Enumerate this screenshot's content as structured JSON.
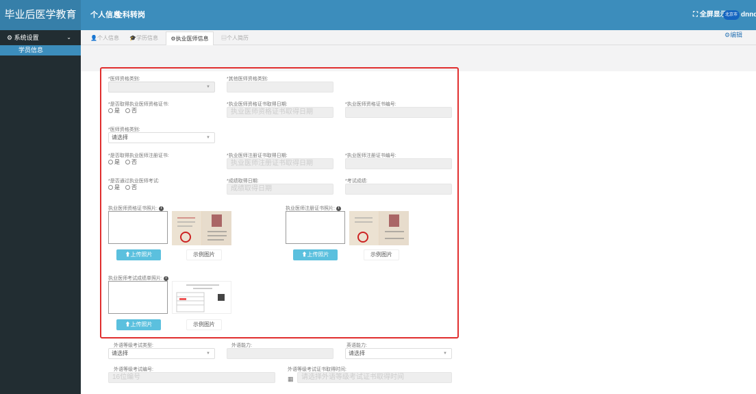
{
  "app": {
    "title": "毕业后医学教育",
    "nav": [
      "个人信息",
      "全科转岗"
    ],
    "fullscreen": "全屏显示",
    "avatar_text": "北京市",
    "username": "dnndnd"
  },
  "sidebar": {
    "group": "系统设置",
    "item": "学员信息"
  },
  "tabs": [
    "个人信息",
    "学历信息",
    "执业医师信息",
    "个人简历"
  ],
  "edit_label": "编辑",
  "form": {
    "qual_type_label": "*医师资格类别:",
    "other_qual_label": "*其他医师资格类别:",
    "has_cert_label": "*是否取得执业医师资格证书:",
    "cert_date_label": "*执业医师资格证书取得日期:",
    "cert_date_placeholder": "执业医师资格证书取得日期",
    "cert_no_label": "*执业医师资格证书编号:",
    "physician_type_label": "*医师资格类别:",
    "physician_type_value": "请选择",
    "has_reg_label": "*是否取得执业医师注册证书:",
    "reg_date_label": "*执业医师注册证书取得日期:",
    "reg_date_placeholder": "执业医师注册证书取得日期",
    "reg_no_label": "*执业医师注册证书编号:",
    "passed_exam_label": "*是否通过执业医师考试:",
    "score_date_label": "*成绩取得日期:",
    "score_date_placeholder": "成绩取得日期",
    "score_label": "*考试成绩:",
    "yes": "是",
    "no": "否"
  },
  "photos": {
    "cert_photo_label": "执业医师资格证书照片:",
    "reg_photo_label": "执业医师注册证书照片:",
    "exam_photo_label": "执业医师考试成绩单照片:",
    "upload": "上传照片",
    "example": "示例图片"
  },
  "lang": {
    "exam_type_label": "外语等级考试类型:",
    "exam_type_value": "请选择",
    "ability_label": "外语能力:",
    "english_label": "英语能力:",
    "english_value": "请选择",
    "exam_no_label": "外语等级考试编号:",
    "exam_no_placeholder": "16位编号",
    "cert_time_label": "外语等级考试证书取得时间:",
    "cert_time_placeholder": "请选择外语等级考试证书取得时间"
  }
}
